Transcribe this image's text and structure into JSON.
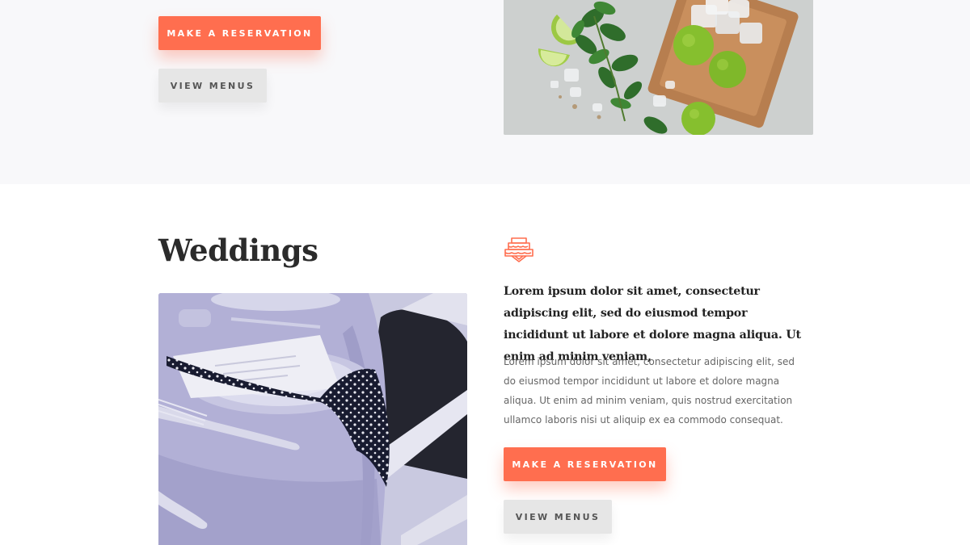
{
  "top_section": {
    "reservation_label": "MAKE A RESERVATION",
    "menus_label": "VIEW MENUS",
    "image_name": "mojito-ingredients-photo"
  },
  "weddings": {
    "title": "Weddings",
    "icon": "wedding-cake-icon",
    "lead": "Lorem ipsum dolor sit amet, consectetur adipiscing elit, sed do eiusmod tempor incididunt ut labore et dolore magna aliqua. Ut enim ad minim veniam,",
    "body": "Lorem ipsum dolor sit amet, consectetur adipiscing elit, sed do eiusmod tempor incididunt ut labore et dolore magna aliqua. Ut enim ad minim veniam, quis nostrud exercitation ullamco laboris nisi ut aliquip ex ea commodo consequat.",
    "reservation_label": "MAKE A RESERVATION",
    "menus_label": "VIEW MENUS",
    "image_name": "wedding-table-setting-photo"
  },
  "colors": {
    "accent": "#ff6e4f",
    "secondary_button": "#e6e6e6",
    "top_background": "#f8f8fa",
    "heading": "#2b2b2b"
  }
}
